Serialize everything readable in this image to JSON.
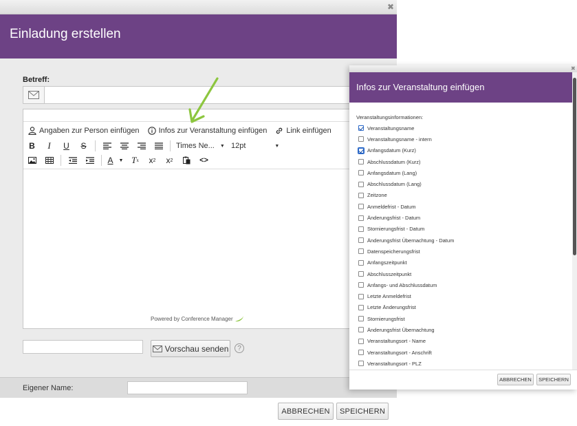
{
  "main_dialog": {
    "title": "Einladung erstellen",
    "close_glyph": "✖",
    "subject": {
      "label": "Betreff:",
      "value": "",
      "icon": "envelope-icon"
    },
    "editor": {
      "insert_toolbar": {
        "person_label": "Angaben zur Person einfügen",
        "event_label": "Infos zur Veranstaltung einfügen",
        "link_label": "Link einfügen"
      },
      "font_family": "Times Ne...",
      "font_size": "12pt",
      "powered_by": "Powered by Conference Manager"
    },
    "preview": {
      "input_value": "",
      "button_label": "Vorschau senden",
      "help_glyph": "?"
    },
    "own_name": {
      "label": "Eigener Name:",
      "value": ""
    },
    "buttons": {
      "cancel": "ABBRECHEN",
      "save": "SPEICHERN"
    }
  },
  "overlay_dialog": {
    "title": "Infos zur Veranstaltung einfügen",
    "close_glyph": "✖",
    "section_label": "Veranstaltungsinformationen:",
    "items": [
      {
        "label": "Veranstaltungsname",
        "checked": true,
        "focused": false
      },
      {
        "label": "Veranstaltungsname - intern",
        "checked": false,
        "focused": false
      },
      {
        "label": "Anfangsdatum (Kurz)",
        "checked": true,
        "focused": true
      },
      {
        "label": "Abschlussdatum (Kurz)",
        "checked": false,
        "focused": false
      },
      {
        "label": "Anfangsdatum (Lang)",
        "checked": false,
        "focused": false
      },
      {
        "label": "Abschlussdatum (Lang)",
        "checked": false,
        "focused": false
      },
      {
        "label": "Zeitzone",
        "checked": false,
        "focused": false
      },
      {
        "label": "Anmeldefrist - Datum",
        "checked": false,
        "focused": false
      },
      {
        "label": "Änderungsfrist - Datum",
        "checked": false,
        "focused": false
      },
      {
        "label": "Stornierungsfrist - Datum",
        "checked": false,
        "focused": false
      },
      {
        "label": "Änderungsfrist Übernachtung - Datum",
        "checked": false,
        "focused": false
      },
      {
        "label": "Datenspeicherungsfrist",
        "checked": false,
        "focused": false
      },
      {
        "label": "Anfangszeitpunkt",
        "checked": false,
        "focused": false
      },
      {
        "label": "Abschlusszeitpunkt",
        "checked": false,
        "focused": false
      },
      {
        "label": "Anfangs- und Abschlussdatum",
        "checked": false,
        "focused": false
      },
      {
        "label": "Letzte Anmeldefrist",
        "checked": false,
        "focused": false
      },
      {
        "label": "Letzte Änderungsfrist",
        "checked": false,
        "focused": false
      },
      {
        "label": "Stornierungsfrist",
        "checked": false,
        "focused": false
      },
      {
        "label": "Änderungsfrist Übernachtung",
        "checked": false,
        "focused": false
      },
      {
        "label": "Veranstaltungsort - Name",
        "checked": false,
        "focused": false
      },
      {
        "label": "Veranstaltungsort - Anschrift",
        "checked": false,
        "focused": false
      },
      {
        "label": "Veranstaltungsort - PLZ",
        "checked": false,
        "focused": false
      }
    ],
    "buttons": {
      "cancel": "ABBRECHEN",
      "save": "SPEICHERN"
    }
  },
  "colors": {
    "header_purple": "#6d4285",
    "arrow_green": "#8dc63f",
    "body_gray": "#ebebeb"
  }
}
